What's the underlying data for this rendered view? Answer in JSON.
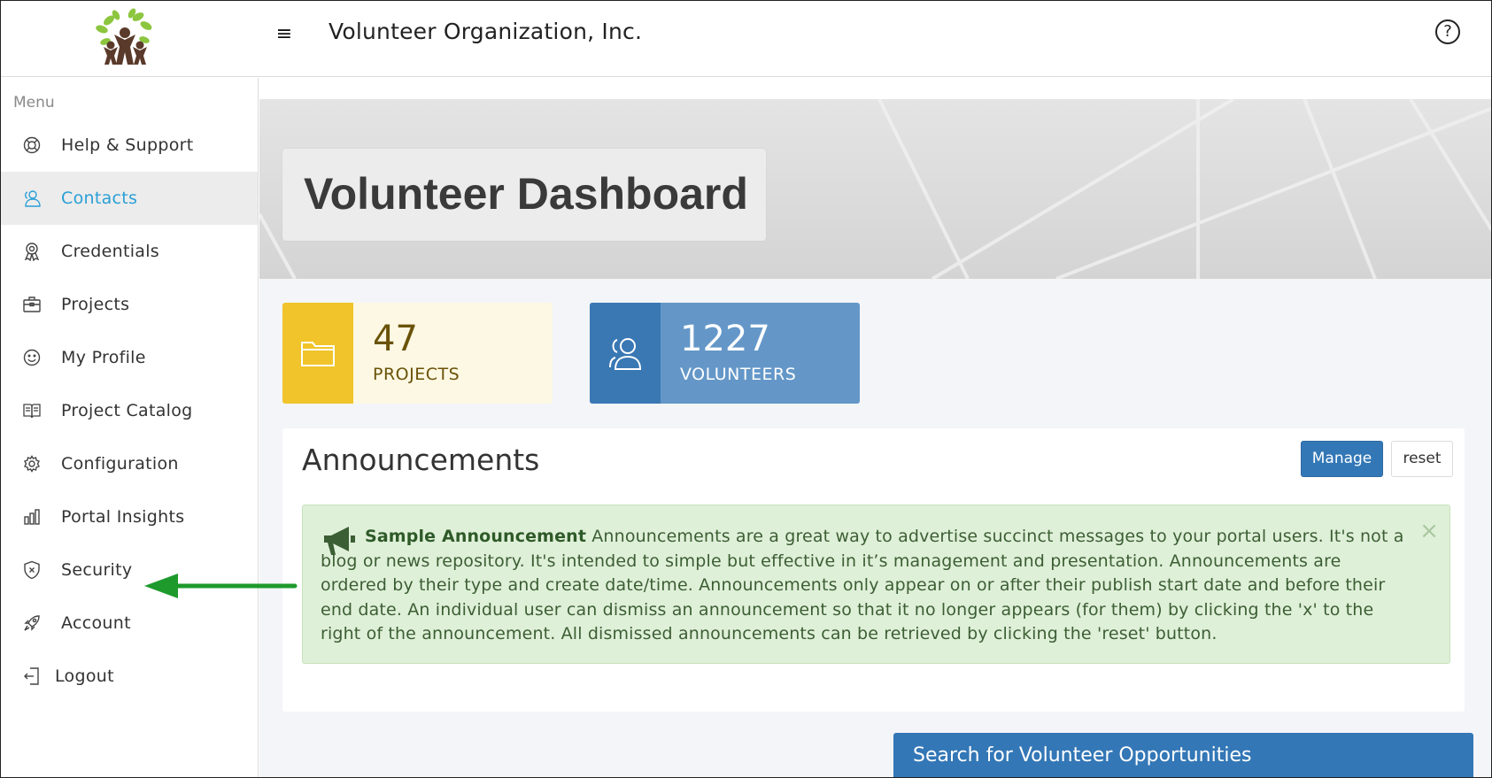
{
  "header": {
    "org_name": "Volunteer Organization, Inc.",
    "menu_icon": "≡",
    "help_icon": "?"
  },
  "sidebar": {
    "title": "Menu",
    "items": [
      {
        "label": "Help & Support",
        "icon": "lifebuoy-icon"
      },
      {
        "label": "Contacts",
        "icon": "contacts-icon",
        "active": true
      },
      {
        "label": "Credentials",
        "icon": "award-icon"
      },
      {
        "label": "Projects",
        "icon": "briefcase-icon"
      },
      {
        "label": "My Profile",
        "icon": "smiley-icon"
      },
      {
        "label": "Project Catalog",
        "icon": "book-icon"
      },
      {
        "label": "Configuration",
        "icon": "gear-icon"
      },
      {
        "label": "Portal Insights",
        "icon": "bar-chart-icon"
      },
      {
        "label": "Security",
        "icon": "shield-icon"
      },
      {
        "label": "Account",
        "icon": "rocket-icon"
      },
      {
        "label": "Logout",
        "icon": "logout-icon"
      }
    ]
  },
  "hero": {
    "title": "Volunteer Dashboard"
  },
  "stats": {
    "projects": {
      "value": "47",
      "label": "PROJECTS",
      "color": "#f0c42a"
    },
    "volunteers": {
      "value": "1227",
      "label": "VOLUNTEERS",
      "color": "#3a78b4"
    }
  },
  "announcements": {
    "title": "Announcements",
    "manage_label": "Manage",
    "reset_label": "reset",
    "items": [
      {
        "title": "Sample Announcement",
        "body": "Announcements are a great way to advertise succinct messages to your portal users. It's not a blog or news repository. It's intended to simple but effective in it’s management and presentation. Announcements are ordered by their type and create date/time. Announcements only appear on or after their publish start date and before their end date. An individual user can dismiss an announcement so that it no longer appears (for them) by clicking the 'x' to the right of the announcement. All dismissed announcements can be retrieved by clicking the 'reset' button.",
        "close": "×"
      }
    ]
  },
  "search": {
    "label": "Search for Volunteer Opportunities"
  },
  "colors": {
    "accent": "#2a9fd6",
    "primary_button": "#3377b6",
    "alert_bg": "#dff0d8",
    "annotation_arrow": "#1e9a2c"
  }
}
